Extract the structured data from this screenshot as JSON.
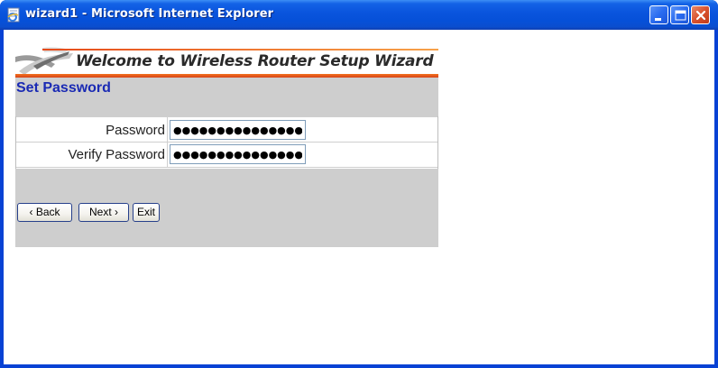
{
  "window": {
    "title": "wizard1 - Microsoft Internet Explorer",
    "app_icon": "ie-page-icon",
    "controls": [
      "minimize-icon",
      "maximize-icon",
      "close-icon"
    ]
  },
  "banner": {
    "text": "Welcome to Wireless Router Setup Wizard"
  },
  "page": {
    "section_title": "Set Password"
  },
  "form": {
    "password_label": "Password",
    "password_value": "●●●●●●●●●●●●●●●",
    "verify_label": "Verify Password",
    "verify_value": "●●●●●●●●●●●●●●●"
  },
  "buttons": {
    "back": "‹ Back",
    "next": "Next ›",
    "exit": "Exit"
  },
  "colors": {
    "titlebar": "#0a55de",
    "section_title": "#1a2ab4",
    "panel": "#cecece",
    "banner_accent": "#e64a1a"
  }
}
